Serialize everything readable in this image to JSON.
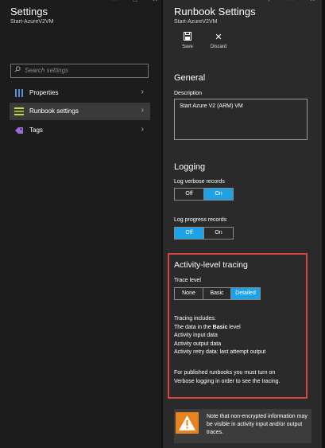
{
  "left_blade": {
    "title": "Settings",
    "subtitle": "Start-AzureV2VM",
    "window_controls": "— □ ✕",
    "search": {
      "placeholder": "Search settings"
    },
    "items": [
      {
        "label": "Properties",
        "icon": "bars-icon"
      },
      {
        "label": "Runbook settings",
        "icon": "list-icon"
      },
      {
        "label": "Tags",
        "icon": "tag-icon"
      }
    ]
  },
  "right_blade": {
    "title": "Runbook Settings",
    "subtitle": "Start-AzureV2VM",
    "window_controls": "↗ — ✕",
    "toolbar": {
      "save_label": "Save",
      "discard_label": "Discard"
    },
    "general": {
      "title": "General",
      "description_label": "Description",
      "description_value": "Start Azure V2 (ARM) VM"
    },
    "logging": {
      "title": "Logging",
      "verbose_label": "Log verbose records",
      "verbose_off": "Off",
      "verbose_on": "On",
      "progress_label": "Log progress records",
      "progress_off": "Off",
      "progress_on": "On"
    },
    "tracing": {
      "title": "Activity-level tracing",
      "trace_level_label": "Trace level",
      "options": [
        "None",
        "Basic",
        "Detailed"
      ],
      "selected": "Detailed",
      "includes_title": "Tracing includes:",
      "line1_prefix": "The data in the ",
      "line1_bold": "Basic",
      "line1_suffix": " level",
      "line2": "Activity input data",
      "line3": "Activity output data",
      "line4": "Activity retry data: last attempt output",
      "note_line1": "For published runbooks you must turn on",
      "note_line2": "Verbose logging in order to see the tracing."
    },
    "warning": {
      "text": "Note that non-encrypted information may be visible in activity input and/or output traces."
    }
  },
  "colors": {
    "accent": "#1ea1e6",
    "highlight_box": "#d8433f",
    "warning_icon": "#e8831f"
  }
}
